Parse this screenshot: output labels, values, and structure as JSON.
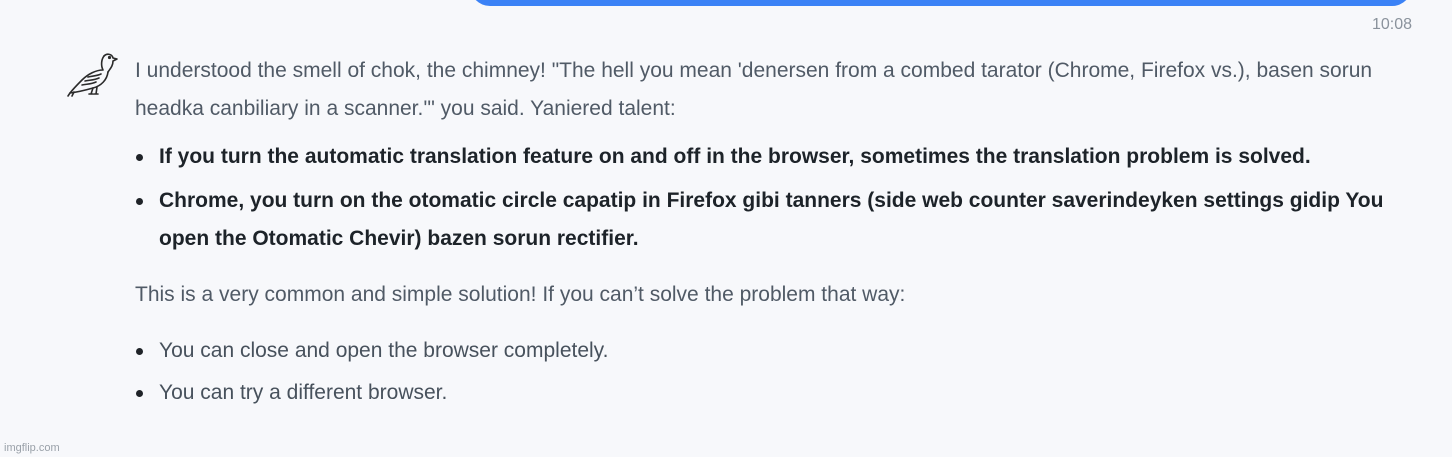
{
  "timestamp": "10:08",
  "avatar_icon": "pigeon-icon",
  "message": {
    "intro": "I understood the smell of chok, the chimney! \"The hell you mean 'denersen from a combed tarator (Chrome, Firefox vs.), basen sorun headka canbiliary in a scanner.'\" you said. Yaniered talent:",
    "tips": [
      "If you turn the automatic translation feature on and off in the browser, sometimes the translation problem is solved.",
      "Chrome, you turn on the otomatic circle capatip in Firefox gibi tanners (side web counter saverindeyken settings gidip You open the Otomatic Chevir) bazen sorun rectifier."
    ],
    "followup": "This is a very common and simple solution! If you can’t solve the problem that way:",
    "alternatives": [
      "You can close and open the browser completely.",
      "You can try a different browser."
    ]
  },
  "watermark": "imgflip.com",
  "colors": {
    "user_bubble": "#3b82f6",
    "background": "#f7f8fb",
    "bold_text": "#1d2329",
    "body_text": "#505a66"
  }
}
